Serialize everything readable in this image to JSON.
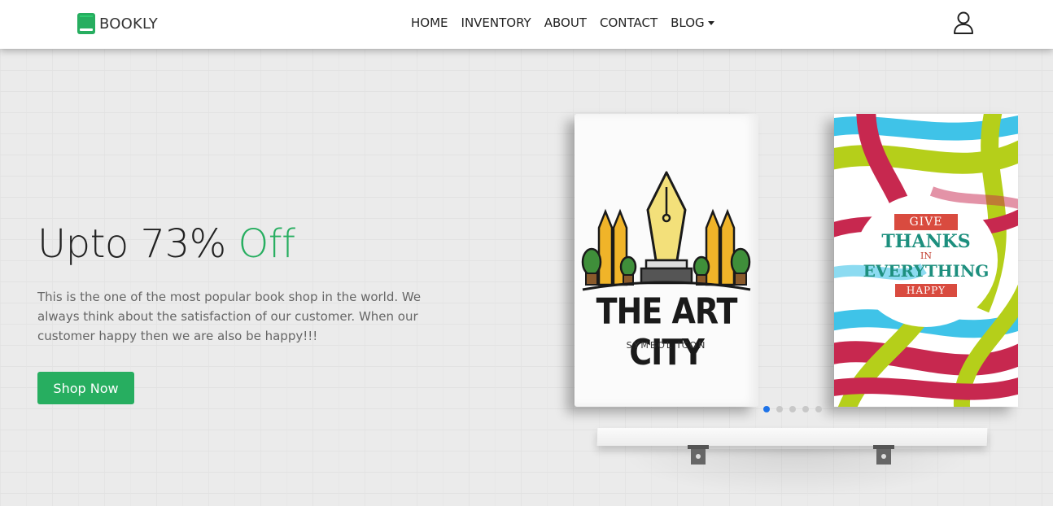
{
  "brand": {
    "name": "BOOKLY",
    "icon": "book-icon",
    "color": "#27ae60"
  },
  "nav": {
    "items": [
      {
        "label": "HOME"
      },
      {
        "label": "INVENTORY"
      },
      {
        "label": "ABOUT"
      },
      {
        "label": "CONTACT"
      },
      {
        "label": "BLOG"
      }
    ],
    "user_icon": "user-icon"
  },
  "hero": {
    "headline_main": "Upto 73% ",
    "headline_accent": "Off",
    "description": "This is the one of the most popular book shop in the world. We always think about the satisfaction of our customer. When our customer happy then we are also be happy!!!",
    "cta_label": "Shop Now",
    "accent_color": "#27ae60"
  },
  "books": [
    {
      "title": "THE ART CITY",
      "subtitle": "SYMBOL ICON"
    },
    {
      "line1": "GIVE",
      "line2": "THANKS",
      "line3": "IN",
      "line4": "EVERYTHING",
      "line5": "HAPPY"
    }
  ],
  "carousel": {
    "slides": 5,
    "active_index": 0,
    "active_color": "#1e73e8"
  }
}
